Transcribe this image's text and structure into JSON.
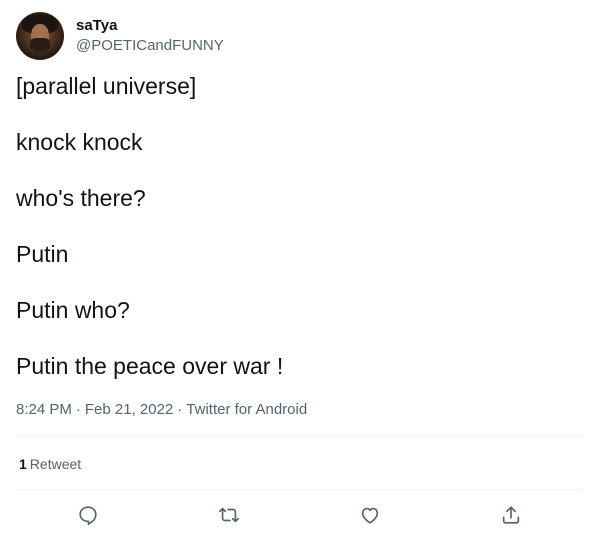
{
  "author": {
    "display_name": "saTya",
    "handle": "@POETICandFUNNY",
    "avatar_icon": "profile-photo"
  },
  "tweet": {
    "lines": [
      "[parallel universe]",
      "knock knock",
      "who's there?",
      "Putin",
      "Putin who?",
      "Putin the peace over war !"
    ],
    "time": "8:24 PM",
    "date": "Feb 21, 2022",
    "source": "Twitter for Android",
    "separator": "·"
  },
  "stats": {
    "retweet_count": "1",
    "retweet_label": "Retweet"
  },
  "actions": {
    "reply_icon": "reply-icon",
    "retweet_icon": "retweet-icon",
    "like_icon": "like-icon",
    "share_icon": "share-icon"
  },
  "colors": {
    "text_primary": "#0f1419",
    "text_secondary": "#536471",
    "divider": "#eff3f4"
  }
}
